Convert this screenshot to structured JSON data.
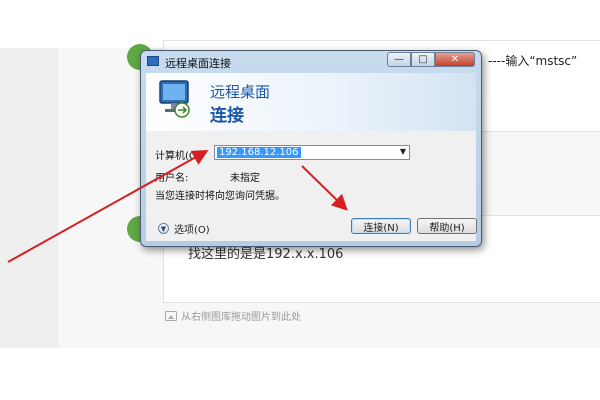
{
  "background": {
    "top_note": "----输入“mstsc”",
    "bottom_note": "找这里的是是192.x.x.106",
    "drop_hint": "从右侧图库拖动图片到此处",
    "step_color": "#5fa844"
  },
  "dialog": {
    "title": "远程桌面连接",
    "header_line1": "远程桌面",
    "header_line2": "连接",
    "computer_label": "计算机(C):",
    "computer_value": "192.168.12.106",
    "user_label": "用户名:",
    "user_value": "未指定",
    "credential_note": "当您连接时将向您询问凭据。",
    "options_label": "选项(O)",
    "connect_button": "连接(N)",
    "help_button": "帮助(H)",
    "accent_color": "#1a56a8",
    "icons": [
      "rdp-window-icon",
      "minimize-icon",
      "maximize-icon",
      "close-icon",
      "remote-desktop-monitor-icon",
      "dropdown-arrow-icon",
      "expand-options-icon"
    ]
  },
  "annotation_color": "#d42020"
}
